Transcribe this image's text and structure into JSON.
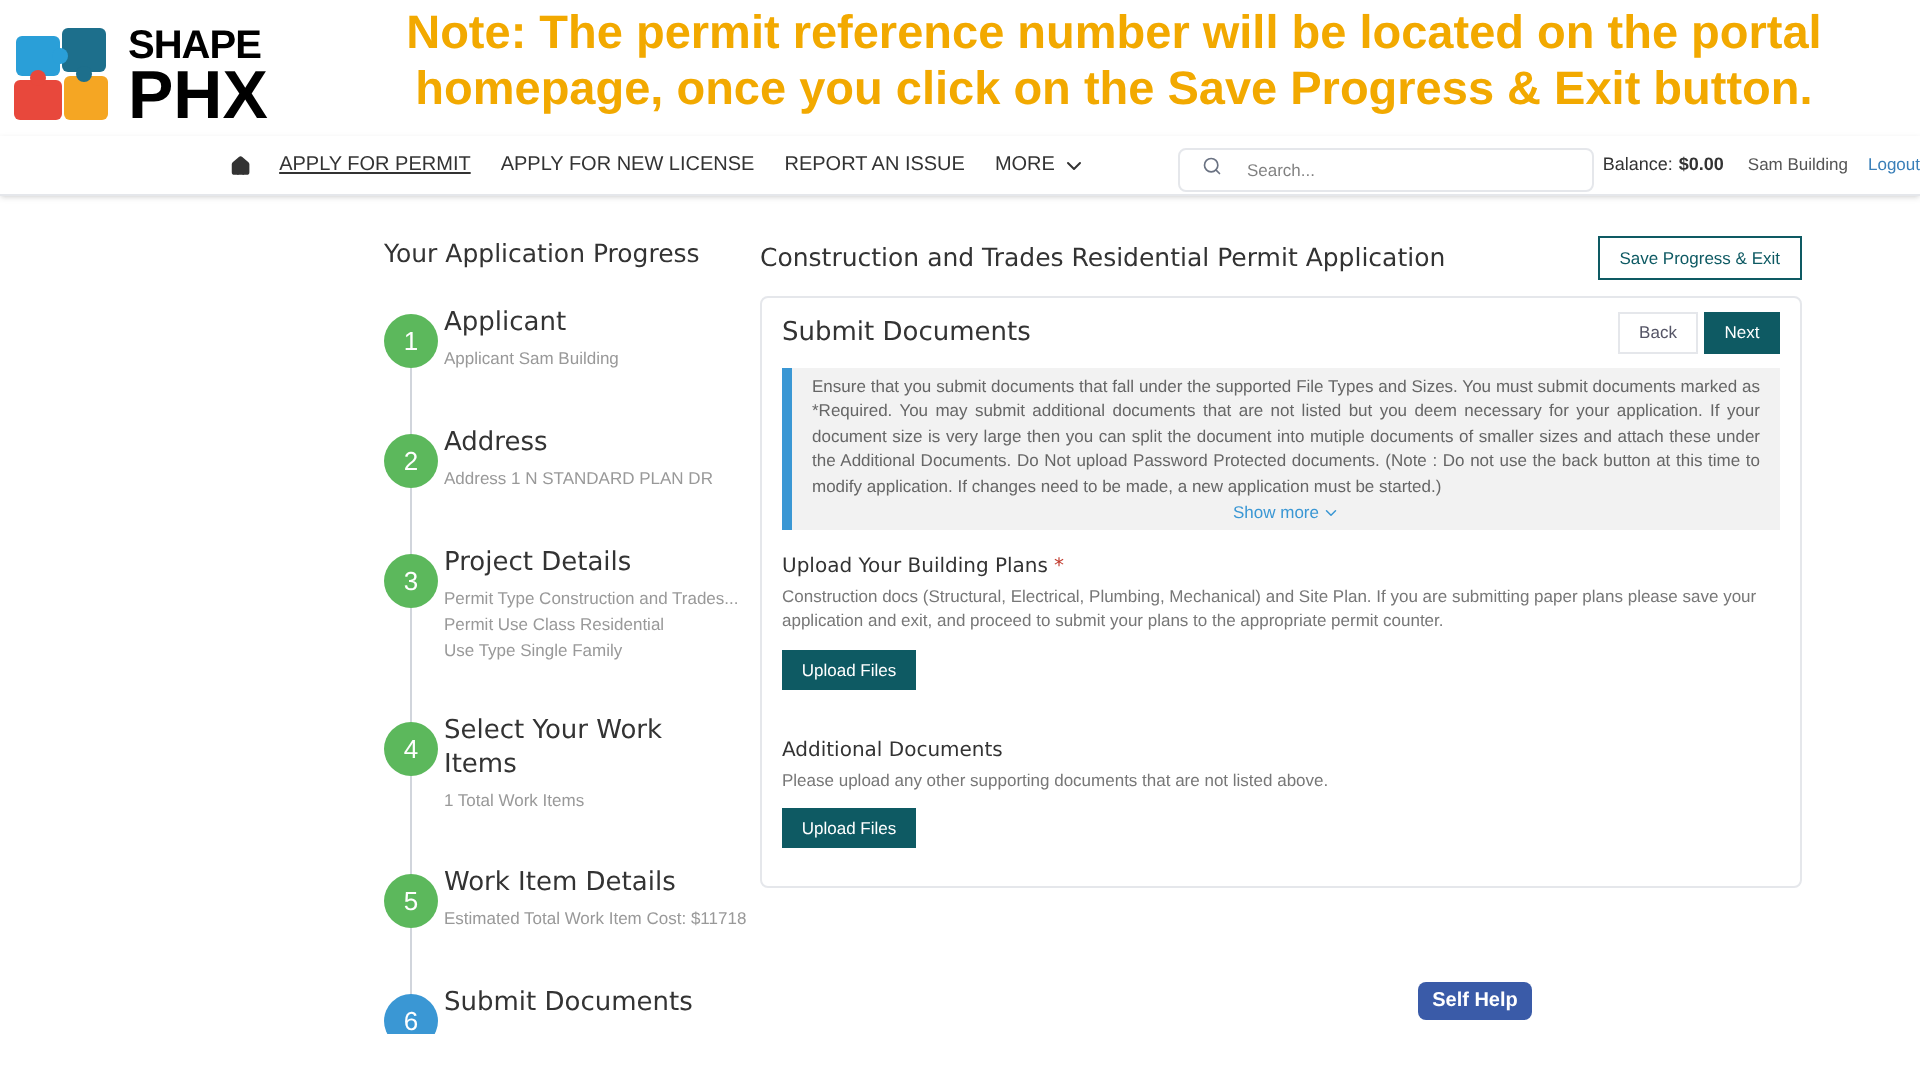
{
  "banner": {
    "logo": [
      "SHAPE",
      "PHX"
    ],
    "note": [
      "Note: The permit reference number will be located on the portal",
      "homepage, once you click on the Save Progress & Exit button."
    ]
  },
  "nav": {
    "items": [
      {
        "label": "APPLY FOR PERMIT",
        "selected": true
      },
      {
        "label": "APPLY FOR NEW LICENSE",
        "selected": false
      },
      {
        "label": "REPORT AN ISSUE",
        "selected": false
      }
    ],
    "more": "MORE",
    "search": {
      "placeholder": "Search..."
    },
    "balance_label": "Balance:",
    "balance": "$0.00",
    "user": "Sam Building",
    "logout": "Logout"
  },
  "progress": {
    "title": "Your Application Progress",
    "steps": [
      {
        "number": "1",
        "title": "Applicant",
        "current": false,
        "details": [
          {
            "label": "Applicant",
            "value": "Sam Building"
          }
        ]
      },
      {
        "number": "2",
        "title": "Address",
        "current": false,
        "details": [
          {
            "label": "Address",
            "value": "1 N STANDARD PLAN DR"
          }
        ]
      },
      {
        "number": "3",
        "title": "Project Details",
        "current": false,
        "details": [
          {
            "label": "Permit Type",
            "value": "Construction and Trades..."
          },
          {
            "label": "Permit Use Class",
            "value": "Residential"
          },
          {
            "label": "Use Type",
            "value": "Single Family"
          }
        ]
      },
      {
        "number": "4",
        "title": "Select Your Work Items",
        "current": false,
        "details": [
          {
            "value": "1 Total Work Items"
          }
        ]
      },
      {
        "number": "5",
        "title": "Work Item Details",
        "current": false,
        "details": [
          {
            "value": "Estimated Total Work Item Cost: $11718"
          }
        ]
      },
      {
        "number": "6",
        "title": "Submit Documents",
        "current": true
      }
    ]
  },
  "application": {
    "title": "Construction and Trades Residential Permit Application",
    "save_button": "Save Progress & Exit",
    "card": {
      "title": "Submit Documents",
      "back": "Back",
      "next": "Next",
      "info": "Ensure that you submit documents that fall under the supported File Types and Sizes. You must submit documents marked as *Required. You may submit additional documents that are not listed but you deem necessary for your application. If your document size is very large then you can split the document into mutiple documents of smaller sizes and attach these under the Additional Documents. Do Not upload Password Protected documents. (Note : Do not use the back button at this time to modify application. If changes need to be made, a new application must be started.)",
      "show_more": "Show more",
      "sections": [
        {
          "title": "Upload Your Building Plans",
          "required_mark": "*",
          "description": "Construction docs (Structural, Electrical, Plumbing, Mechanical) and Site Plan. If you are submitting paper plans please save your application and exit, and proceed to submit your plans to the appropriate permit counter.",
          "button": "Upload Files"
        },
        {
          "title": "Additional Documents",
          "description": "Please upload any other supporting documents that are not listed above.",
          "button": "Upload Files"
        }
      ]
    }
  },
  "self_help": "Self Help"
}
